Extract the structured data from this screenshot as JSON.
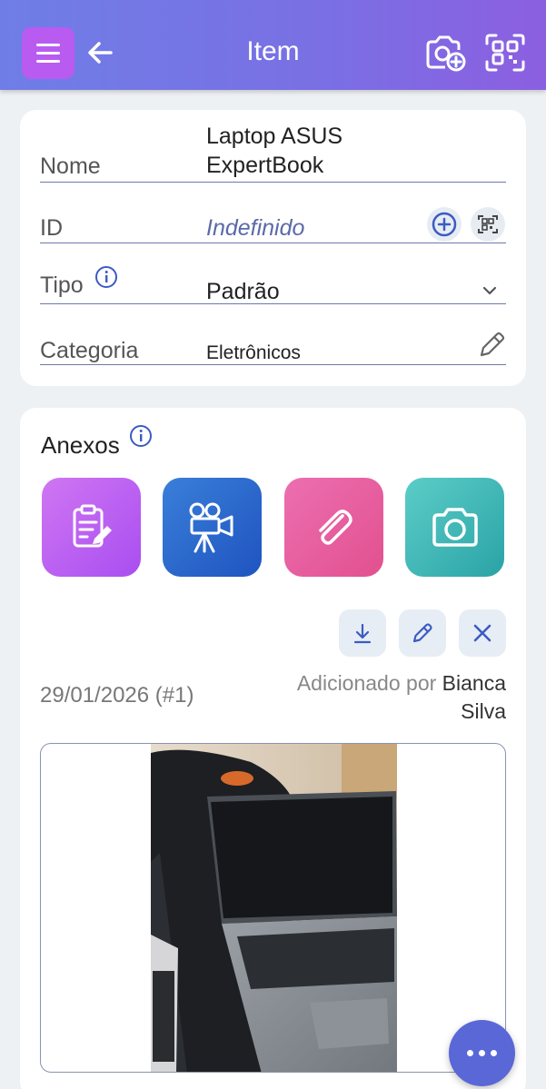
{
  "header": {
    "title": "Item"
  },
  "form": {
    "nome_label": "Nome",
    "nome_value_line1": "Laptop ASUS",
    "nome_value_line2": "ExpertBook",
    "id_label": "ID",
    "id_value": "Indefinido",
    "tipo_label": "Tipo",
    "tipo_value": "Padrão",
    "categoria_label": "Categoria",
    "categoria_value": "Eletrônicos"
  },
  "attachments": {
    "title": "Anexos",
    "buttons": [
      "note-icon",
      "video-camera-icon",
      "paperclip-icon",
      "camera-icon"
    ],
    "entry": {
      "date": "29/01/2026 (#1)",
      "added_by_prefix": "Adicionado por",
      "added_by_first": "Bianca",
      "added_by_last": "Silva"
    }
  },
  "colors": {
    "appbar_start": "#6f7ee6",
    "appbar_end": "#8c5fe0",
    "menu": "#b95bf0",
    "fab": "#5a67d6",
    "accent": "#3b5bc4"
  }
}
